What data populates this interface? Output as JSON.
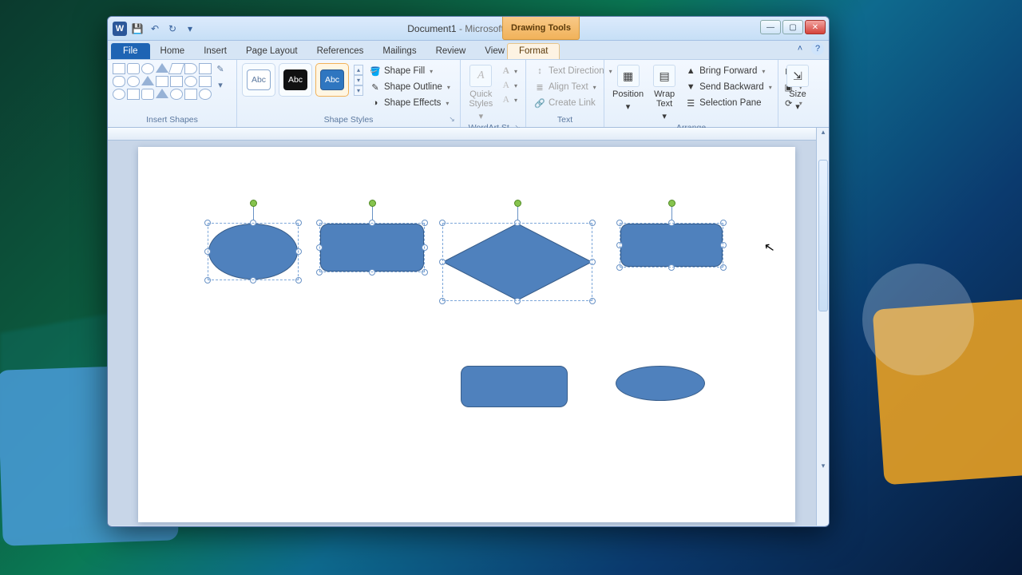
{
  "title": {
    "doc": "Document1",
    "app": "Microsoft Word"
  },
  "contextual_tab_group": "Drawing Tools",
  "qat": {
    "save": "💾",
    "undo": "↶",
    "redo": "↻",
    "custom": "▾"
  },
  "window_controls": {
    "min": "—",
    "max": "▢",
    "close": "✕"
  },
  "tabs": {
    "file": "File",
    "items": [
      "Home",
      "Insert",
      "Page Layout",
      "References",
      "Mailings",
      "Review",
      "View"
    ],
    "context": "Format",
    "minimize_ribbon": "˄",
    "help": "?"
  },
  "ribbon": {
    "insert_shapes": {
      "label": "Insert Shapes",
      "edit_shape": "✎",
      "more": "▾"
    },
    "shape_styles": {
      "label": "Shape Styles",
      "swatch_text": "Abc",
      "fill": "Shape Fill",
      "outline": "Shape Outline",
      "effects": "Shape Effects"
    },
    "wordart": {
      "label": "WordArt St…",
      "quick_styles": "Quick Styles"
    },
    "text": {
      "label": "Text",
      "direction": "Text Direction",
      "align": "Align Text",
      "link": "Create Link"
    },
    "arrange": {
      "label": "Arrange",
      "position": "Position",
      "wrap": "Wrap Text",
      "bring": "Bring Forward",
      "send": "Send Backward",
      "pane": "Selection Pane",
      "align_btn": "⊞",
      "group_btn": "▣",
      "rotate_btn": "⟳"
    },
    "size": {
      "label": "Size"
    }
  },
  "icons": {
    "fill": "🪣",
    "outline": "✎",
    "effects": "◑",
    "textdir": "↕",
    "aligntext": "≣",
    "link": "🔗",
    "position": "▦",
    "wrap": "▤",
    "bring": "▲",
    "send": "▼",
    "pane": "☰",
    "caret": "▾",
    "launcher": "↘"
  }
}
